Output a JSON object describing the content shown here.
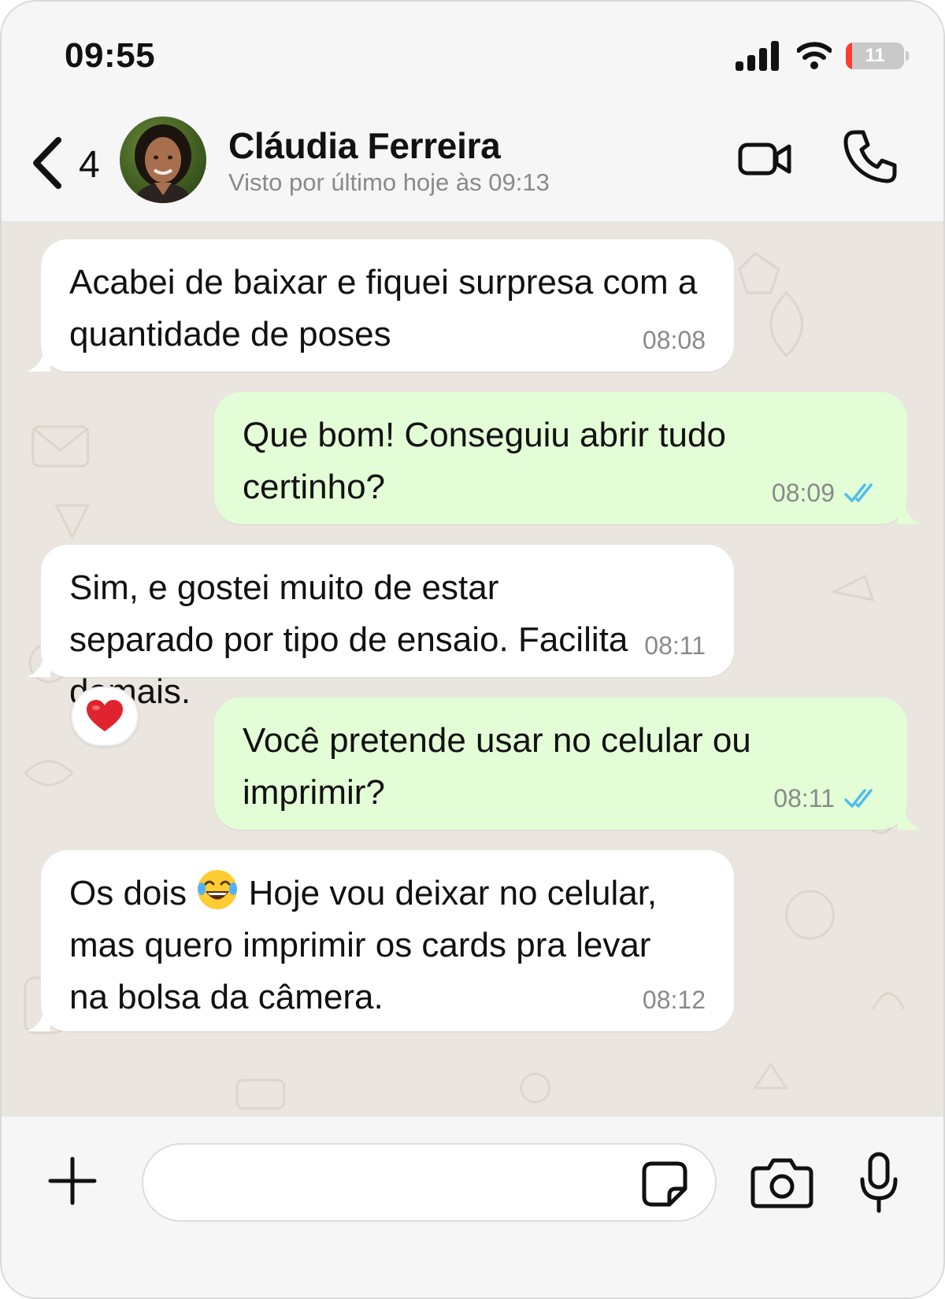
{
  "status_bar": {
    "time": "09:55",
    "battery_level": "11",
    "battery_fraction": 0.11
  },
  "header": {
    "back_count": "4",
    "contact_name": "Cláudia Ferreira",
    "last_seen": "Visto por último hoje às 09:13"
  },
  "messages": [
    {
      "direction": "incoming",
      "text": "Acabei de baixar e fiquei surpresa com a quantidade de poses",
      "time": "08:08"
    },
    {
      "direction": "outgoing",
      "text": "Que bom! Conseguiu abrir tudo certinho?",
      "time": "08:09",
      "status": "read"
    },
    {
      "direction": "incoming",
      "text": "Sim, e gostei muito de estar separado por tipo de ensaio. Facilita demais.",
      "time": "08:11",
      "reaction": "❤️"
    },
    {
      "direction": "outgoing",
      "text": "Você pretende usar no celular ou imprimir?",
      "time": "08:11",
      "status": "read"
    },
    {
      "direction": "incoming",
      "text_before_emoji": "Os dois",
      "emoji": "😂",
      "text_after_emoji": " Hoje vou deixar no celular, mas quero imprimir os cards pra levar na bolsa da câmera.",
      "time": "08:12"
    }
  ],
  "input": {
    "value": "",
    "placeholder": ""
  },
  "colors": {
    "incoming_bubble": "#ffffff",
    "outgoing_bubble": "#e3fdd6",
    "read_ticks": "#53bdeb",
    "wallpaper": "#eae6df",
    "battery_low": "#ff3b30"
  },
  "icons": [
    "back-chevron-icon",
    "video-call-icon",
    "phone-icon",
    "double-check-icon",
    "plus-icon",
    "sticker-icon",
    "camera-icon",
    "mic-icon",
    "heart-reaction-icon",
    "laughing-emoji-icon"
  ]
}
